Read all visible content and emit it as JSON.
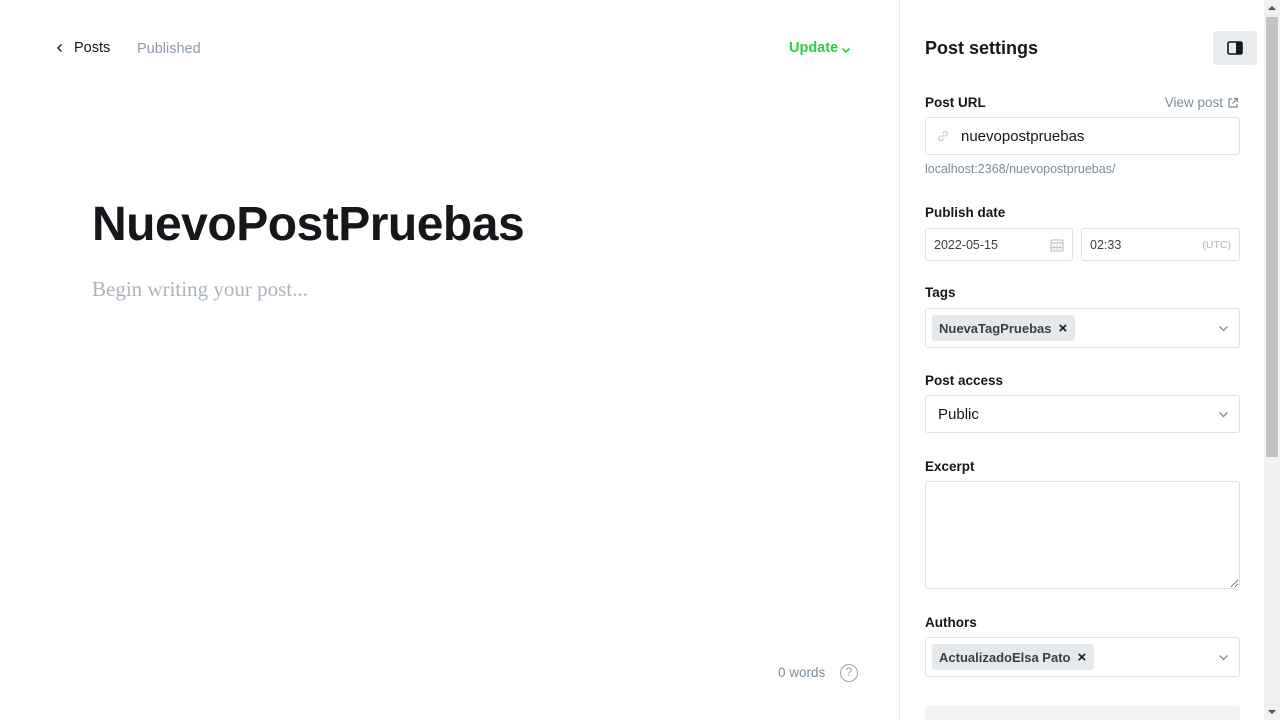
{
  "editor": {
    "back_label": "Posts",
    "status": "Published",
    "update_label": "Update",
    "title": "NuevoPostPruebas",
    "body_placeholder": "Begin writing your post...",
    "word_count": "0 words",
    "help_symbol": "?"
  },
  "settings": {
    "title": "Post settings",
    "post_url": {
      "label": "Post URL",
      "view_post_label": "View post",
      "slug": "nuevopostpruebas",
      "full_url": "localhost:2368/nuevopostpruebas/"
    },
    "publish_date": {
      "label": "Publish date",
      "date": "2022-05-15",
      "time": "02:33",
      "timezone": "(UTC)"
    },
    "tags": {
      "label": "Tags",
      "items": [
        "NuevaTagPruebas"
      ]
    },
    "post_access": {
      "label": "Post access",
      "value": "Public"
    },
    "excerpt": {
      "label": "Excerpt",
      "value": ""
    },
    "authors": {
      "label": "Authors",
      "items": [
        "ActualizadoElsa Pato"
      ]
    }
  },
  "colors": {
    "accent_green": "#30cf43",
    "text_dark": "#15171a",
    "text_muted": "#7c8b9a",
    "border": "#dde1e5"
  },
  "icons": [
    "chevron-left-icon",
    "chevron-down-icon",
    "sidebar-toggle-icon",
    "external-link-icon",
    "link-icon",
    "calendar-icon",
    "close-icon",
    "help-icon"
  ]
}
